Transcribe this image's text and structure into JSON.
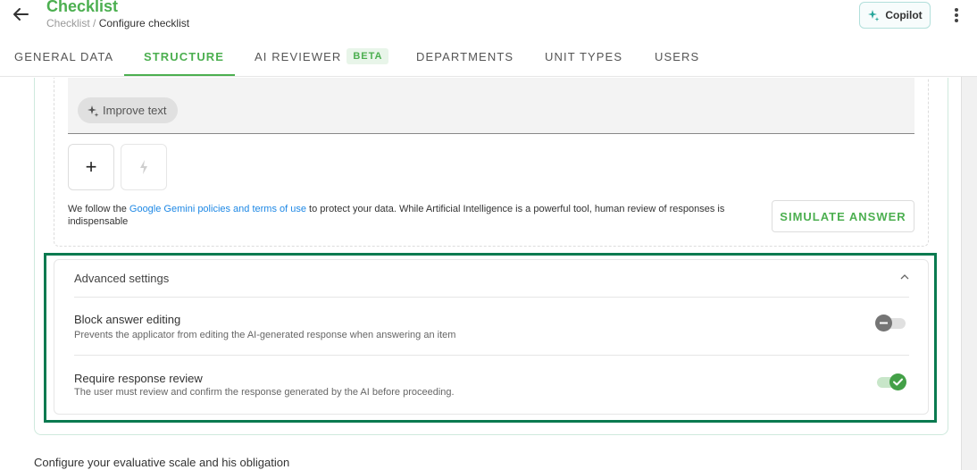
{
  "header": {
    "title": "Checklist",
    "breadcrumb_parent": "Checklist",
    "breadcrumb_sep": " / ",
    "breadcrumb_current": "Configure checklist",
    "copilot_label": "Copilot"
  },
  "tabs": [
    {
      "label": "GENERAL DATA"
    },
    {
      "label": "STRUCTURE",
      "active": true
    },
    {
      "label": "AI REVIEWER",
      "badge": "BETA"
    },
    {
      "label": "DEPARTMENTS"
    },
    {
      "label": "UNIT TYPES"
    },
    {
      "label": "USERS"
    }
  ],
  "ai_section": {
    "improve_label": "Improve text",
    "add_symbol": "+",
    "policy_prefix": "We follow the ",
    "policy_link": "Google Gemini policies and terms of use",
    "policy_suffix": " to protect your data. While Artificial Intelligence is a powerful tool, human review of responses is indispensable",
    "simulate_label": "SIMULATE ANSWER"
  },
  "advanced": {
    "title": "Advanced settings",
    "settings": [
      {
        "title": "Block answer editing",
        "desc": "Prevents the applicator from editing the AI-generated response when answering an item",
        "enabled": false
      },
      {
        "title": "Require response review",
        "desc": "The user must review and confirm the response generated by the AI before proceeding.",
        "enabled": true
      }
    ]
  },
  "footer": {
    "scale_text": "Configure your evaluative scale and his obligation"
  },
  "colors": {
    "accent": "#4caf50",
    "highlight_frame": "#0a7a50",
    "link": "#1e88e5"
  }
}
